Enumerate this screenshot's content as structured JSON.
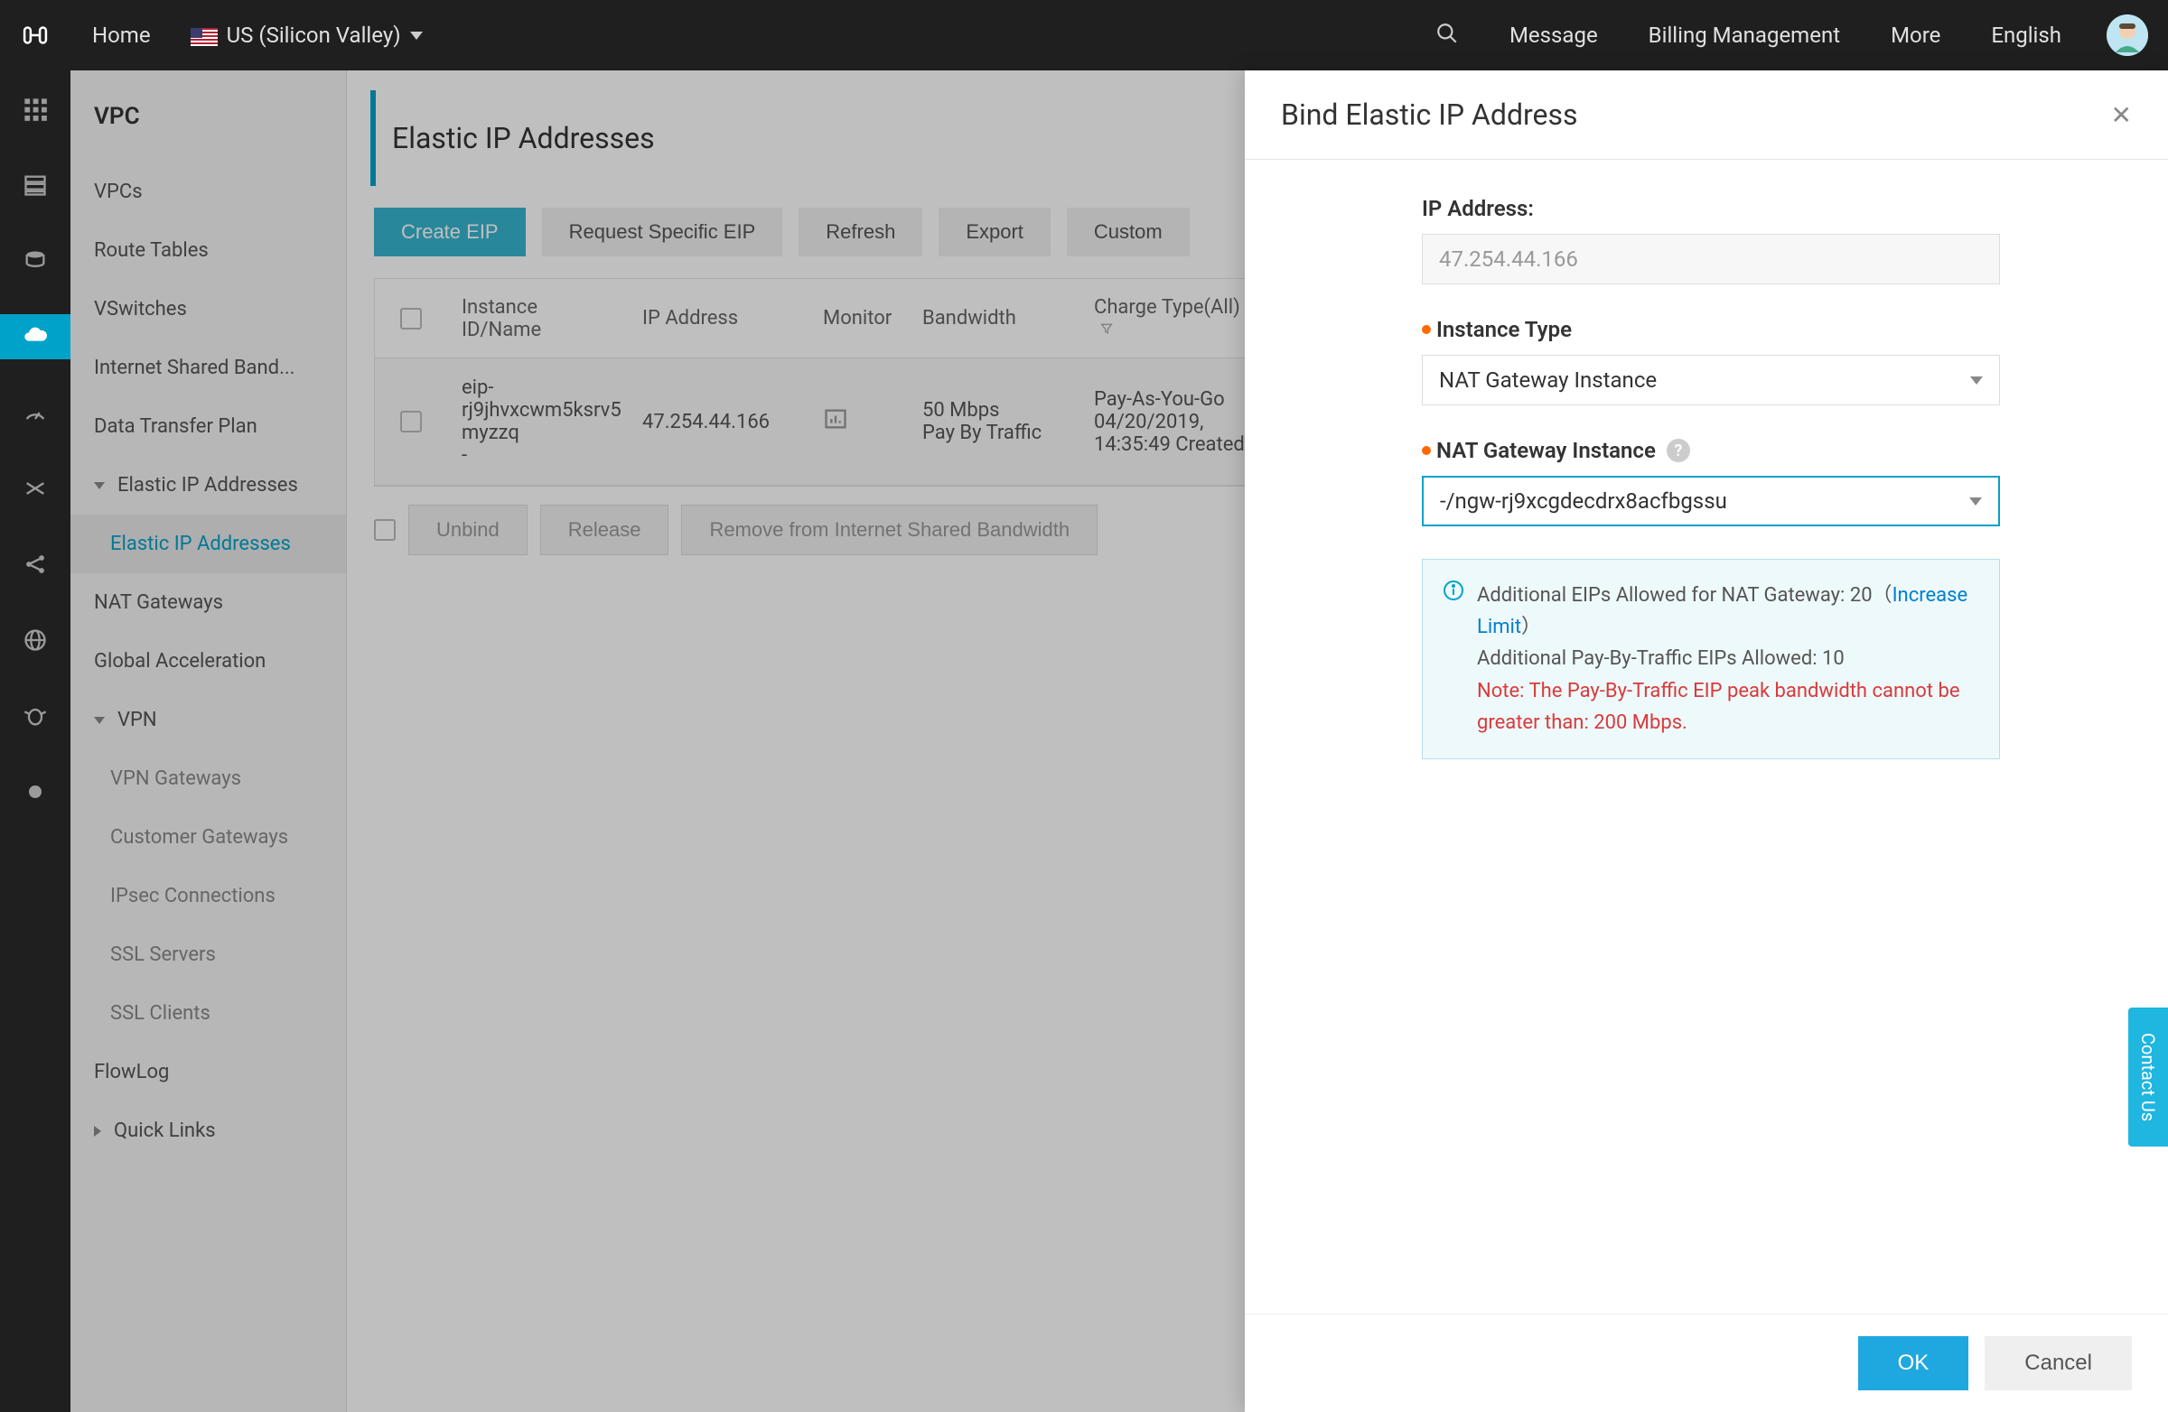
{
  "topbar": {
    "home": "Home",
    "region": "US (Silicon Valley)",
    "message": "Message",
    "billing": "Billing Management",
    "more": "More",
    "english": "English"
  },
  "sidebar": {
    "title": "VPC",
    "items": {
      "vpcs": "VPCs",
      "route_tables": "Route Tables",
      "vswitches": "VSwitches",
      "internet_shared": "Internet Shared Band...",
      "data_transfer": "Data Transfer Plan",
      "eip_group": "Elastic IP Addresses",
      "eip": "Elastic IP Addresses",
      "nat": "NAT Gateways",
      "ga": "Global Acceleration",
      "vpn_group": "VPN",
      "vpn_gw": "VPN Gateways",
      "cust_gw": "Customer Gateways",
      "ipsec": "IPsec Connections",
      "ssl_srv": "SSL Servers",
      "ssl_cli": "SSL Clients",
      "flowlog": "FlowLog",
      "quick": "Quick Links"
    }
  },
  "page": {
    "title": "Elastic IP Addresses",
    "buttons": {
      "create": "Create EIP",
      "request": "Request Specific EIP",
      "refresh": "Refresh",
      "export": "Export",
      "custom": "Custom"
    },
    "columns": {
      "instance": "Instance ID/Name",
      "ip": "IP Address",
      "monitor": "Monitor",
      "bandwidth": "Bandwidth",
      "charge": "Charge Type(All)"
    },
    "row": {
      "instance_l1": "eip-",
      "instance_l2": "rj9jhvxcwm5ksrv5",
      "instance_l3": "myzzq",
      "instance_l4": "-",
      "ip": "47.254.44.166",
      "bw_l1": "50 Mbps",
      "bw_l2": "Pay By Traffic",
      "charge_l1": "Pay-As-You-Go",
      "charge_l2": "04/20/2019,",
      "charge_l3": "14:35:49 Created"
    },
    "bulk": {
      "unbind": "Unbind",
      "release": "Release",
      "remove": "Remove from Internet Shared Bandwidth"
    }
  },
  "drawer": {
    "title": "Bind Elastic IP Address",
    "ip_label": "IP Address:",
    "ip_value": "47.254.44.166",
    "type_label": "Instance Type",
    "type_value": "NAT Gateway Instance",
    "nat_label": "NAT Gateway Instance",
    "nat_value": "-/ngw-rj9xcgdecdrx8acfbgssu",
    "info_l1a": "Additional EIPs Allowed for NAT Gateway: 20（",
    "info_link": "Increase Limit",
    "info_l1b": "）",
    "info_l2": "Additional Pay-By-Traffic EIPs Allowed: 10",
    "info_note": "Note: The Pay-By-Traffic EIP peak bandwidth cannot be greater than: 200 Mbps.",
    "ok": "OK",
    "cancel": "Cancel"
  },
  "contact": "Contact Us"
}
